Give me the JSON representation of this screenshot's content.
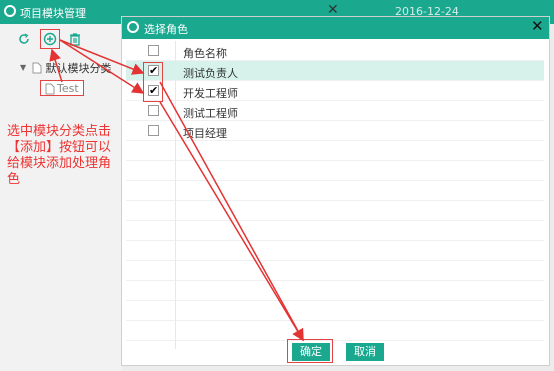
{
  "background_window": {
    "title": "项目模块管理",
    "date": "2016-12-24",
    "close_glyph": "✕",
    "tree": {
      "root": "默认模块分类",
      "child": "Test"
    },
    "annotation": "选中模块分类点击【添加】按钮可以给模块添加处理角色"
  },
  "dialog": {
    "title": "选择角色",
    "close_glyph": "✕",
    "header": "角色名称",
    "rows": [
      {
        "label": "测试负责人",
        "checked": true,
        "highlighted": true
      },
      {
        "label": "开发工程师",
        "checked": true,
        "highlighted": false
      },
      {
        "label": "测试工程师",
        "checked": false,
        "highlighted": false
      },
      {
        "label": "项目经理",
        "checked": false,
        "highlighted": false
      }
    ],
    "confirm_label": "确定",
    "cancel_label": "取消"
  },
  "icons": [
    "refresh-icon",
    "add-icon",
    "delete-icon",
    "folder-icon",
    "document-icon",
    "logo-icon"
  ],
  "colors": {
    "accent": "#1aa88f",
    "annotation": "#e33333",
    "selected_row": "#d6f2ea"
  }
}
